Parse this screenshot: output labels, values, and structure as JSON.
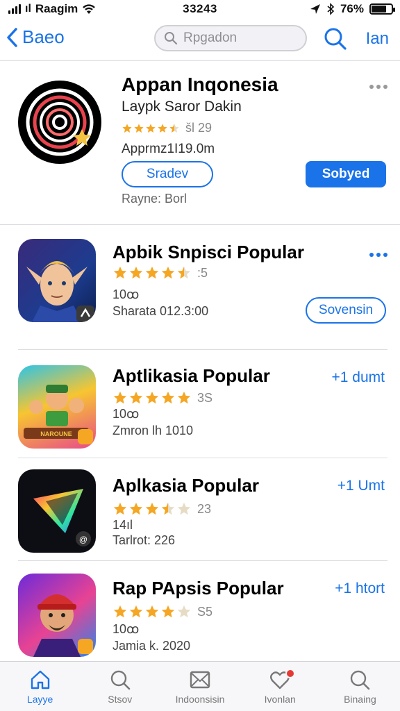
{
  "status_bar": {
    "carrier": "Raagim",
    "time": "33243",
    "battery": "76%",
    "battery_level": 0.76
  },
  "nav": {
    "back_label": "Baeo",
    "search_placeholder": "Rpgadon",
    "right_label": "Ian"
  },
  "featured": {
    "title": "Appan Inqonesia",
    "subtitle": "Laypk Saror Dakin",
    "rating_value": 4.5,
    "rating_text": "šl 29",
    "meta": "Apprmz1I19.0m",
    "outline_button": "Sradev",
    "filled_button": "Sobyed",
    "footer": "Rayne: Borl"
  },
  "apps": [
    {
      "title": "Apbik Snpisci Popular",
      "rating_value": 4.5,
      "rating_text": ":5",
      "line1": "10ꝏ",
      "line2": "Sharata 012.3:00",
      "action": "Sovensin",
      "action_style": "outline",
      "icon": "elf-warrior-icon"
    },
    {
      "title": "Aptlikasia Popular",
      "rating_value": 5,
      "rating_text": "3S",
      "line1": "10ꝏ",
      "line2": "Zmron lh 1010",
      "action": "+1 dumt",
      "action_style": "text",
      "icon": "cartoon-family-icon"
    },
    {
      "title": "Aplkasia Popular",
      "rating_value": 3.5,
      "rating_text": "23",
      "line1": "14ıl",
      "line2": "Tarlrot: 226",
      "action": "+1 Umt",
      "action_style": "text",
      "icon": "prism-icon"
    },
    {
      "title": "Rap PApsis Popular",
      "rating_value": 4,
      "rating_text": "S5",
      "line1": "10ꝏ",
      "line2": "Jamia k. 2020",
      "action": "+1 htort",
      "action_style": "text",
      "icon": "cap-man-icon"
    }
  ],
  "tabs": [
    {
      "label": "Layye",
      "icon": "home-icon",
      "active": true
    },
    {
      "label": "Stsov",
      "icon": "search-icon",
      "active": false
    },
    {
      "label": "Indoonsisin",
      "icon": "mail-icon",
      "active": false
    },
    {
      "label": "Ivonlan",
      "icon": "heart-icon",
      "active": false,
      "badge": true
    },
    {
      "label": "Binaing",
      "icon": "search-icon",
      "active": false
    }
  ],
  "colors": {
    "accent": "#1a73e8",
    "star": "#f5a623",
    "badge": "#e53935"
  }
}
